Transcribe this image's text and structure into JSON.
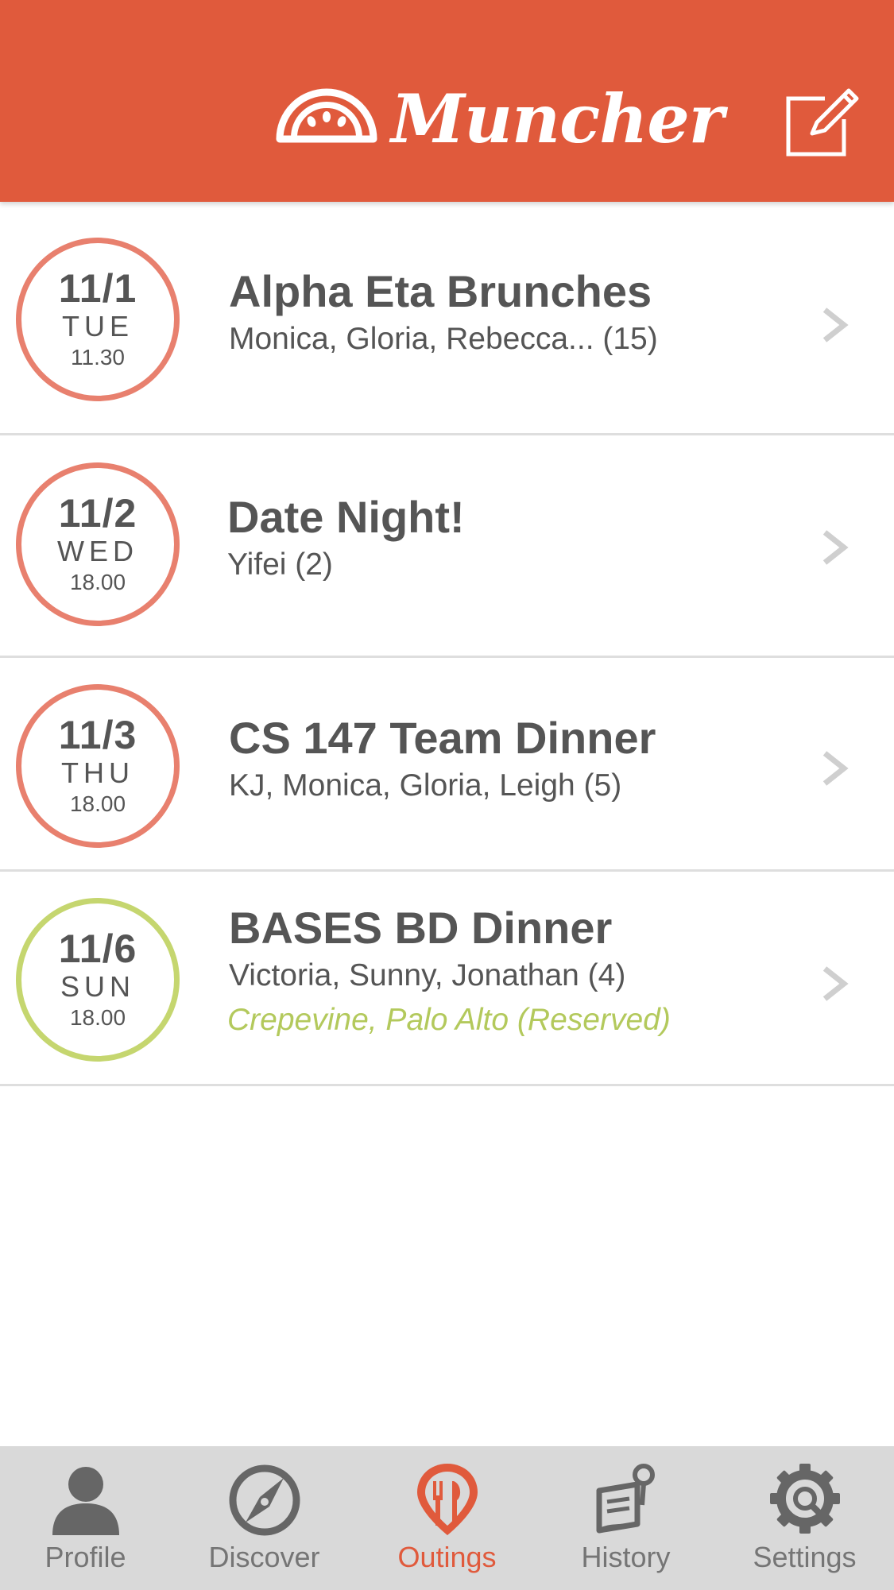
{
  "header": {
    "app_name": "Muncher",
    "logo_icon": "muncher-logo-icon",
    "compose_icon": "compose-icon",
    "colors": {
      "brand": "#e05a3c",
      "text": "#ffffff"
    }
  },
  "outings": [
    {
      "date": "11/1",
      "day": "TUE",
      "time": "11.30",
      "title": "Alpha Eta Brunches",
      "attendees": "Monica, Gloria, Rebecca... (15)",
      "place": "",
      "status_color": "#e8806e"
    },
    {
      "date": "11/2",
      "day": "WED",
      "time": "18.00",
      "title": "Date Night!",
      "attendees": "Yifei (2)",
      "place": "",
      "status_color": "#e8806e"
    },
    {
      "date": "11/3",
      "day": "THU",
      "time": "18.00",
      "title": "CS 147 Team Dinner",
      "attendees": "KJ, Monica, Gloria, Leigh (5)",
      "place": "",
      "status_color": "#e8806e"
    },
    {
      "date": "11/6",
      "day": "SUN",
      "time": "18.00",
      "title": "BASES BD Dinner",
      "attendees": "Victoria, Sunny, Jonathan (4)",
      "place": "Crepevine, Palo Alto (Reserved)",
      "status_color": "#c5d66f"
    }
  ],
  "tabs": [
    {
      "label": "Profile",
      "icon": "person-icon",
      "active": false
    },
    {
      "label": "Discover",
      "icon": "compass-icon",
      "active": false
    },
    {
      "label": "Outings",
      "icon": "utensils-pin-icon",
      "active": true
    },
    {
      "label": "History",
      "icon": "map-history-icon",
      "active": false
    },
    {
      "label": "Settings",
      "icon": "gear-icon",
      "active": false
    }
  ],
  "colors": {
    "accent": "#e05a3c",
    "pending_ring": "#e8806e",
    "reserved_ring": "#c5d66f",
    "reserved_text": "#b3c95c",
    "tabbar_bg": "#d9d9d9",
    "tab_inactive": "#757575"
  }
}
